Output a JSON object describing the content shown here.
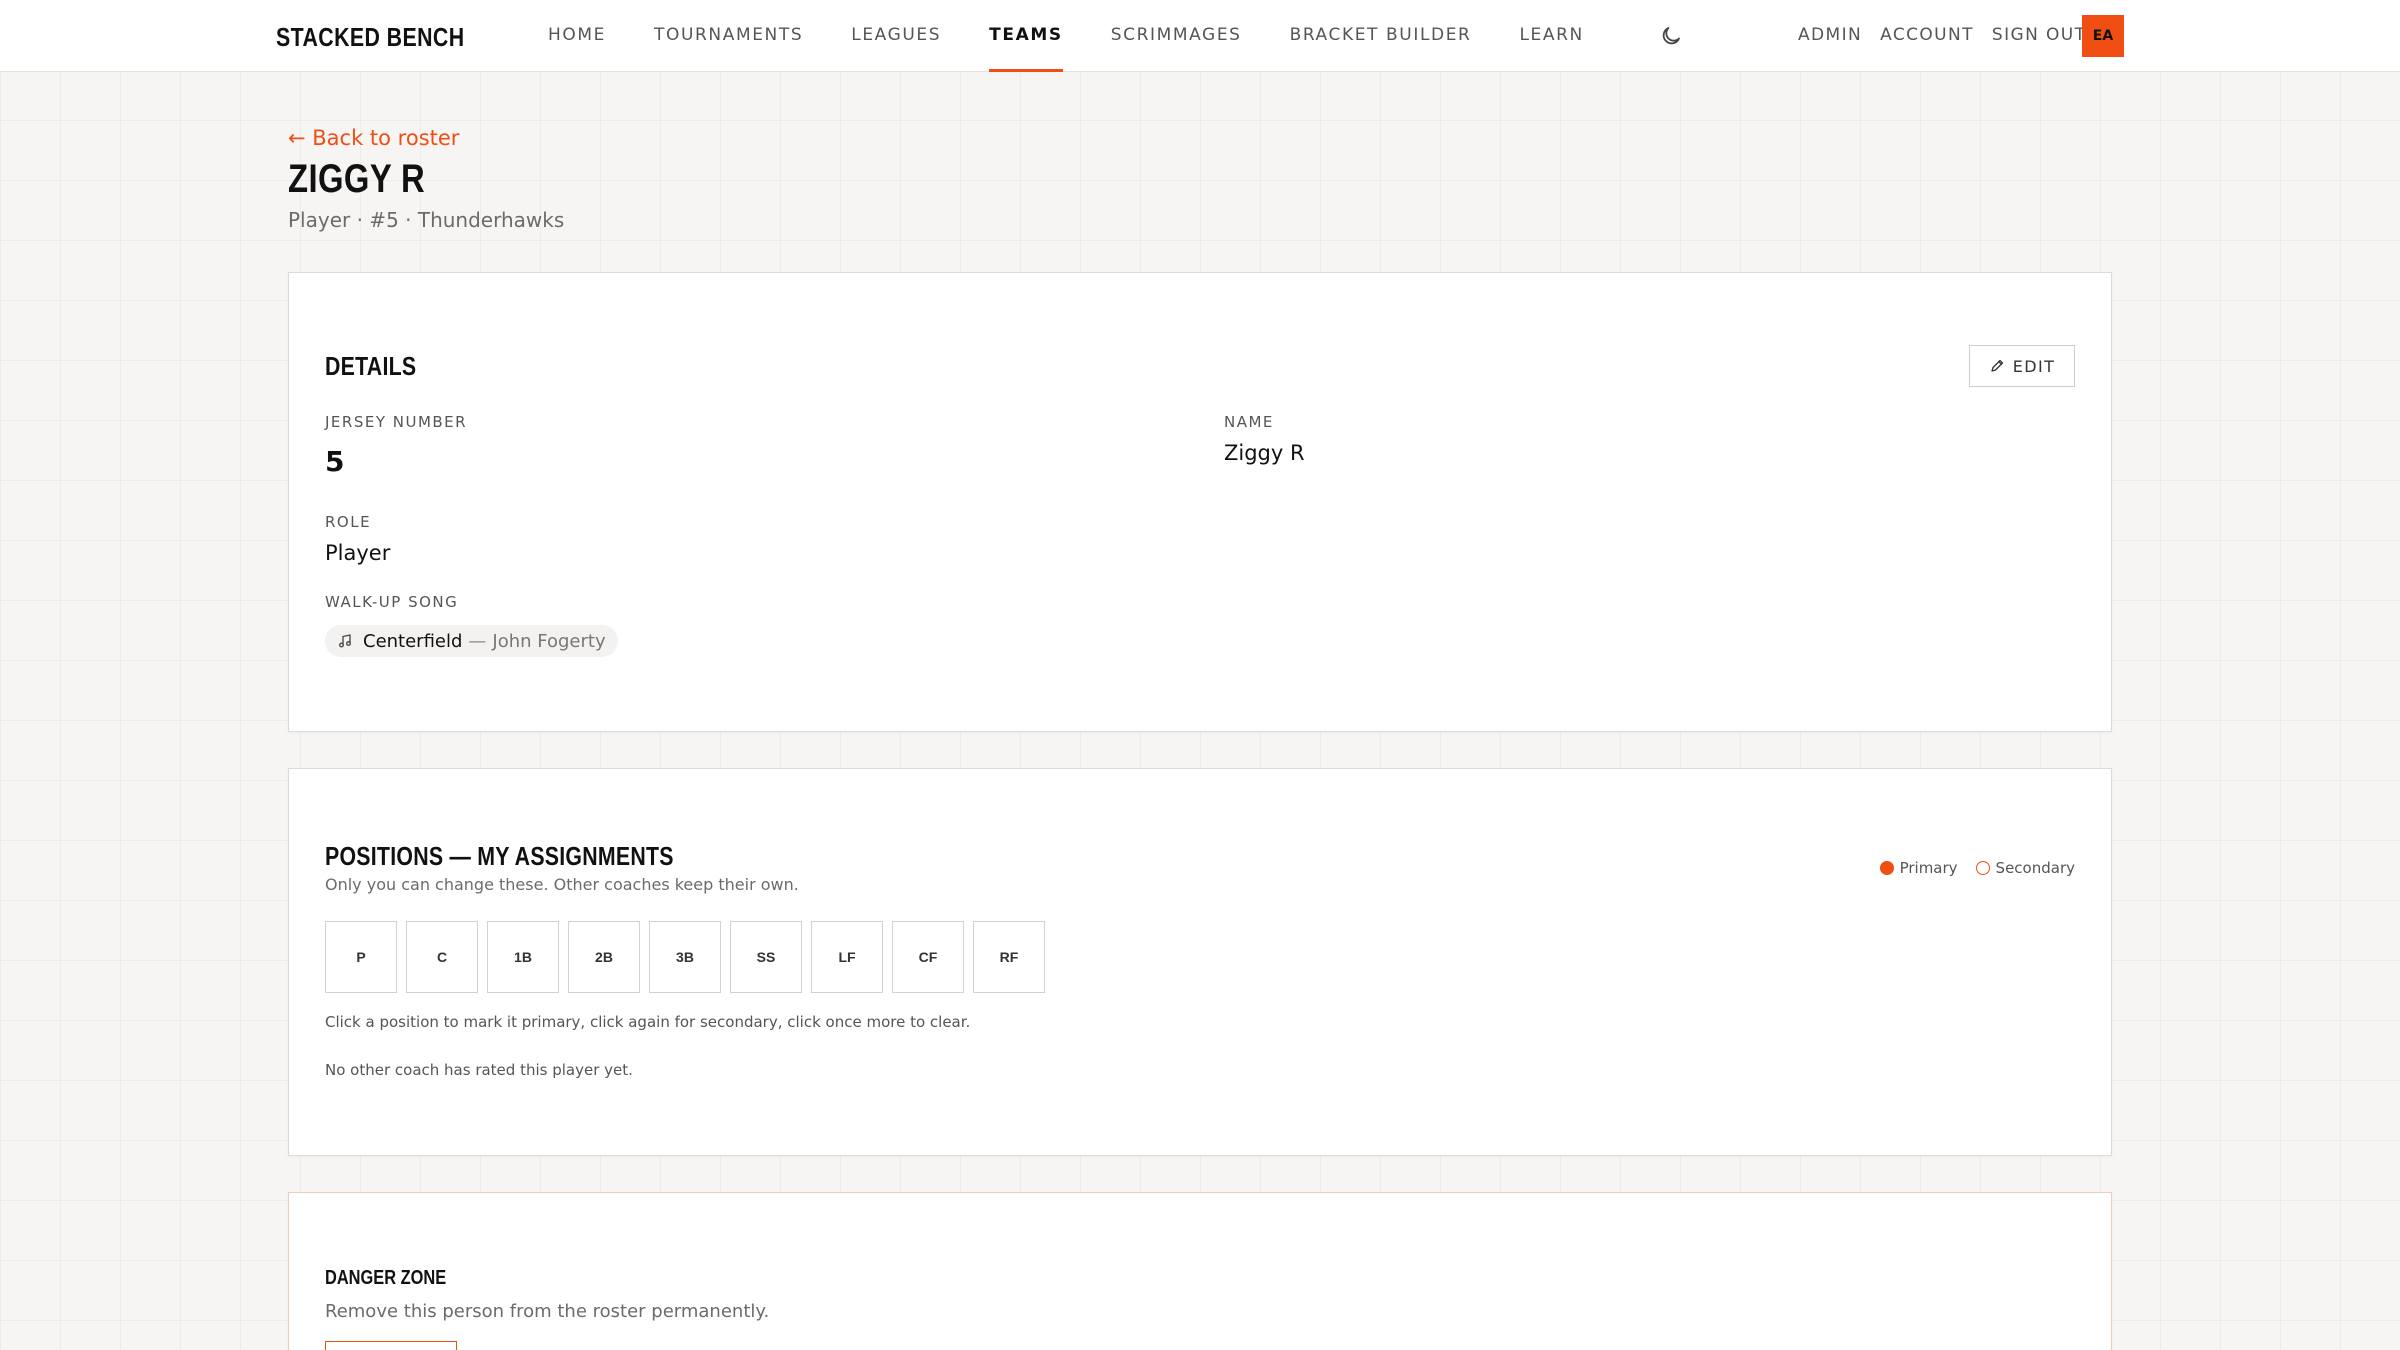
{
  "app": {
    "brand": "STACKED BENCH"
  },
  "nav": {
    "links": [
      "HOME",
      "TOURNAMENTS",
      "LEAGUES",
      "TEAMS",
      "SCRIMMAGES",
      "BRACKET BUILDER",
      "LEARN"
    ],
    "active": "TEAMS",
    "right": [
      "ADMIN",
      "ACCOUNT",
      "SIGN OUT"
    ],
    "avatar_initials": "EA",
    "theme_toggle_icon": "moon-icon"
  },
  "header": {
    "back_link": "← Back to roster",
    "title": "ZIGGY R",
    "subtitle": "Player · #5 · Thunderhawks"
  },
  "details": {
    "title": "DETAILS",
    "edit_label": "EDIT",
    "jersey_label": "JERSEY NUMBER",
    "jersey_value": "5",
    "name_label": "NAME",
    "name_value": "Ziggy R",
    "role_label": "ROLE",
    "role_value": "Player",
    "song_label": "WALK-UP SONG",
    "song_title": "Centerfield",
    "song_sep": "—",
    "song_artist": "John Fogerty"
  },
  "positions": {
    "title": "POSITIONS — MY ASSIGNMENTS",
    "description": "Only you can change these. Other coaches keep their own.",
    "legend_primary": "Primary",
    "legend_secondary": "Secondary",
    "buttons": [
      "P",
      "C",
      "1B",
      "2B",
      "3B",
      "SS",
      "LF",
      "CF",
      "RF"
    ],
    "hint": "Click a position to mark it primary, click again for secondary, click once more to clear.",
    "other_coaches": "No other coach has rated this player yet."
  },
  "danger": {
    "title": "DANGER ZONE",
    "description": "Remove this person from the roster permanently."
  },
  "colors": {
    "accent": "#f04e12",
    "background": "#f6f5f3"
  }
}
